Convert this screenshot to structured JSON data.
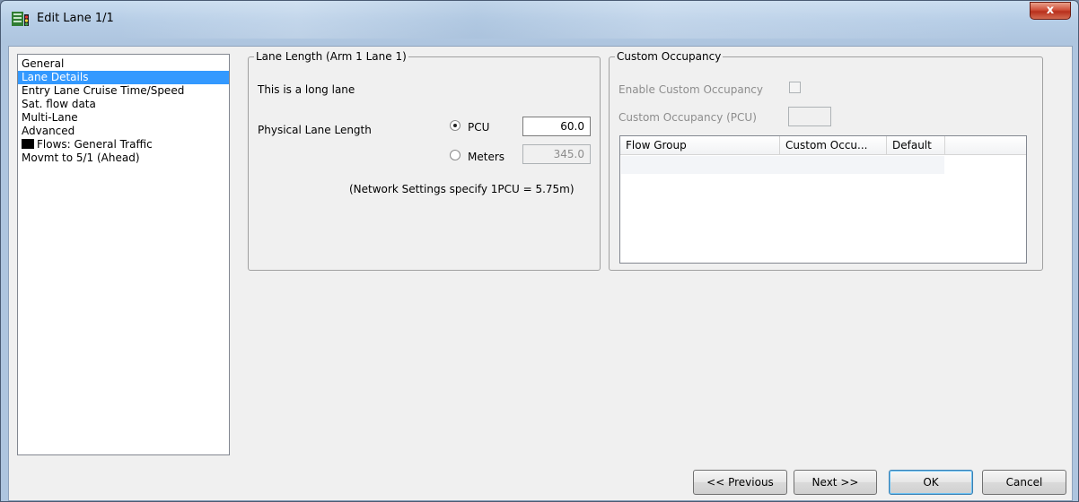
{
  "window": {
    "title": "Edit Lane 1/1",
    "close_label": "x"
  },
  "nav": {
    "items": [
      {
        "label": "General",
        "selected": false
      },
      {
        "label": "Lane Details",
        "selected": true
      },
      {
        "label": "Entry Lane Cruise Time/Speed",
        "selected": false
      },
      {
        "label": "Sat. flow data",
        "selected": false
      },
      {
        "label": "Multi-Lane",
        "selected": false
      },
      {
        "label": "Advanced",
        "selected": false
      },
      {
        "label": "Flows: General Traffic",
        "selected": false,
        "swatch_color": "#000000"
      },
      {
        "label": "Movmt to 5/1 (Ahead)",
        "selected": false
      }
    ]
  },
  "lane_length": {
    "legend": "Lane Length (Arm 1 Lane 1)",
    "long_lane_text": "This is a long lane",
    "physical_label": "Physical Lane Length",
    "pcu_label": "PCU",
    "pcu_value": "60.0",
    "pcu_selected": true,
    "meters_label": "Meters",
    "meters_value": "345.0",
    "meters_selected": false,
    "network_note": "(Network Settings specify 1PCU = 5.75m)"
  },
  "custom_occupancy": {
    "legend": "Custom Occupancy",
    "enable_label": "Enable Custom Occupancy",
    "enable_checked": false,
    "pcu_label": "Custom Occupancy (PCU)",
    "pcu_value": "",
    "columns": [
      "Flow Group",
      "Custom Occu...",
      "Default"
    ]
  },
  "buttons": {
    "previous": "<< Previous",
    "next": "Next >>",
    "ok": "OK",
    "cancel": "Cancel"
  },
  "colors": {
    "selection": "#3399ff",
    "dialog_bg": "#f0f0f0",
    "close_button": "#c9432f"
  }
}
